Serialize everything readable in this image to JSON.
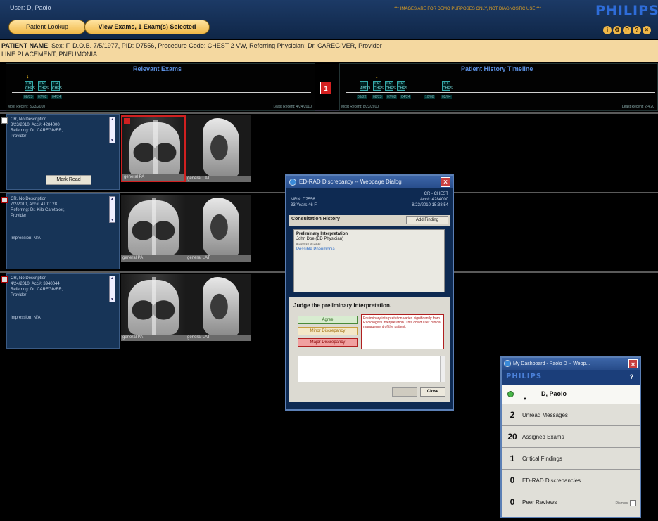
{
  "header": {
    "user_label": "User: D, Paolo",
    "demo_note": "*** IMAGES ARE FOR DEMO PURPOSES ONLY, NOT DIAGNOSTIC USE ***",
    "brand": "PHILIPS",
    "tabs": [
      {
        "label": "Patient Lookup"
      },
      {
        "label": "View Exams, 1 Exam(s) Selected"
      }
    ],
    "icons": [
      "info-icon",
      "settings-icon",
      "print-icon",
      "help-icon",
      "close-icon"
    ]
  },
  "patient": {
    "name_label": "PATIENT NAME",
    "details": ": Sex: F, D.O.B. 7/5/1977, PID: D7556, Procedure Code: CHEST 2 VW, Referring Physician: Dr. CAREGIVER, Provider",
    "line2": "LINE PLACEMENT, PNEUMONIA"
  },
  "timeline": {
    "relevant_title": "Relevant Exams",
    "history_title": "Patient History Timeline",
    "left_most_recent": "Most Recent: 8/23/2010",
    "left_least_recent": "Least Recent: 4/24/2010",
    "right_most_recent": "Most Recent: 8/23/2010",
    "right_least_recent": "Least Recent: 2/4/20",
    "badge_count": "1"
  },
  "exams": [
    {
      "description": "CR, No Description\n8/23/2010, Acc#: 4284000\nReferring: Dr. CAREGIVER,\nProvider",
      "impression": "",
      "mark_read_label": "Mark Read",
      "images": [
        "general PA",
        "general LAT"
      ]
    },
    {
      "description": "CR, No Description\n7/2/2010, Acc#: 4101128\nReferring: Dr. Kilo Caretaker,\nProvider",
      "impression": "Impression: N/A",
      "images": [
        "general PA",
        "general LAT"
      ]
    },
    {
      "description": "CR, No Description\n4/24/2010, Acc#: 3940044\nReferring: Dr. CAREGIVER,\nProvider",
      "impression": "Impression: N/A",
      "images": [
        "general PA",
        "general LAT"
      ]
    }
  ],
  "dialog": {
    "title": "ED-RAD Discrepancy -- Webpage Dialog",
    "mrn": "MRN: D7556",
    "age": "33 Years 46 F",
    "exam_type": "CR - CHEST",
    "acc": "Acc#: 4284000",
    "datetime": "8/23/2010 15:38:54",
    "consult_tab": "Consultation History",
    "add_finding": "Add Finding",
    "prelim_head": "Preliminary Interpretation",
    "prelim_author": "John Doe (ED Physician)",
    "prelim_date": "8/23/2010 16:23:32",
    "prelim_finding": "Possible Pneumonia",
    "judge_title": "Judge the preliminary interpretation.",
    "agree": "Agree",
    "minor": "Minor Discrepancy",
    "major": "Major Discrepancy",
    "major_desc": "Preliminary interpretation varies significantly from Radiologists interpretation. This could alter clinical management of the patient.",
    "close": "Close"
  },
  "dashboard": {
    "title": "My Dashboard - Paolo D -- Webp...",
    "brand": "PHILIPS",
    "help": "?",
    "user": "D, Paolo",
    "items": [
      {
        "count": "2",
        "label": "Unread Messages"
      },
      {
        "count": "20",
        "label": "Assigned Exams"
      },
      {
        "count": "1",
        "label": "Critical Findings"
      },
      {
        "count": "0",
        "label": "ED-RAD Discrepancies"
      },
      {
        "count": "0",
        "label": "Peer Reviews"
      }
    ],
    "dismiss": "Dismiss"
  }
}
